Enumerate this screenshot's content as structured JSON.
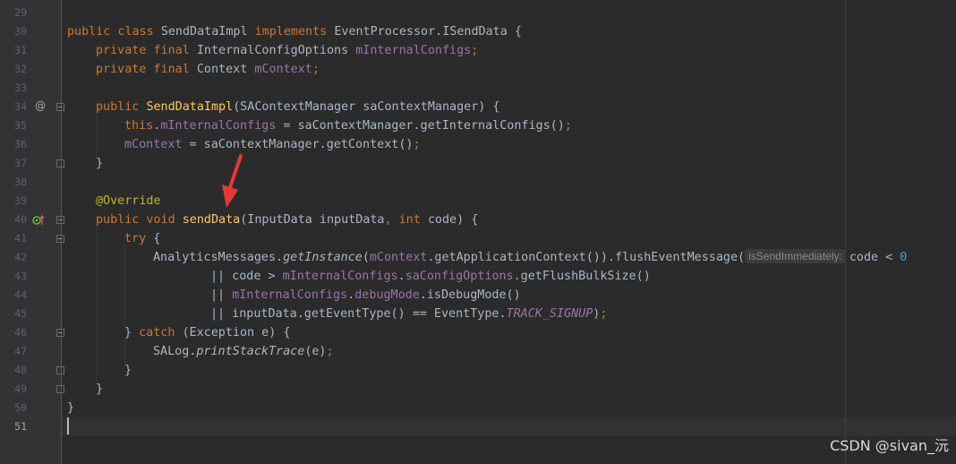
{
  "line_numbers": [
    "29",
    "30",
    "31",
    "32",
    "33",
    "34",
    "35",
    "36",
    "37",
    "38",
    "39",
    "40",
    "41",
    "42",
    "43",
    "44",
    "45",
    "46",
    "47",
    "48",
    "49",
    "50",
    "51"
  ],
  "code": {
    "l30": {
      "kw1": "public class ",
      "cls": "SendDataImpl ",
      "kw2": "implements ",
      "rest": "EventProcessor.ISendData {"
    },
    "l31": {
      "kw": "private final ",
      "type": "InternalConfigOptions ",
      "field": "mInternalConfigs",
      "end": ";"
    },
    "l32": {
      "kw": "private final ",
      "type": "Context ",
      "field": "mContext",
      "end": ";"
    },
    "l34": {
      "kw": "public ",
      "name": "SendDataImpl",
      "params": "(SAContextManager saContextManager) {"
    },
    "l35": {
      "kw": "this",
      "dot": ".",
      "field": "mInternalConfigs",
      "rest": " = saContextManager.getInternalConfigs()",
      "end": ";"
    },
    "l36": {
      "field": "mContext",
      "rest": " = saContextManager.getContext()",
      "end": ";"
    },
    "l37": {
      "text": "}"
    },
    "l39": {
      "annotation": "@Override"
    },
    "l40": {
      "kw1": "public void ",
      "name": "sendData",
      "p1": "(InputData inputData",
      "comma": ", ",
      "kw2": "int ",
      "p2": "code) {"
    },
    "l41": {
      "kw": "try ",
      "rest": "{"
    },
    "l42": {
      "a": "AnalyticsMessages.",
      "b": "getInstance",
      "c": "(",
      "d": "mContext",
      "e": ".getApplicationContext()).flushEventMessage(",
      "hint": "isSendImmediately:",
      "f": "code < ",
      "g": "0"
    },
    "l43": {
      "a": "|| code > ",
      "b": "mInternalConfigs",
      "c": ".",
      "d": "saConfigOptions",
      "e": ".getFlushBulkSize()"
    },
    "l44": {
      "a": "|| ",
      "b": "mInternalConfigs",
      "c": ".",
      "d": "debugMode",
      "e": ".isDebugMode()"
    },
    "l45": {
      "a": "|| inputData.getEventType() == EventType.",
      "b": "TRACK_SIGNUP",
      "c": ")",
      "d": ";"
    },
    "l46": {
      "a": "} ",
      "b": "catch ",
      "c": "(Exception e) {"
    },
    "l47": {
      "a": "SALog.",
      "b": "printStackTrace",
      "c": "(e)",
      "d": ";"
    },
    "l48": {
      "text": "}"
    },
    "l49": {
      "text": "}"
    },
    "l50": {
      "text": "}"
    }
  },
  "icons": {
    "override": "@"
  },
  "watermark": "CSDN @sivan_沅",
  "colors": {
    "background": "#2b2b2b",
    "keyword": "#cc7832",
    "field": "#9876aa",
    "method": "#ffc66d",
    "annotation": "#bbb529",
    "number": "#6897bb",
    "default": "#a9b7c6",
    "arrow": "#e53935"
  }
}
